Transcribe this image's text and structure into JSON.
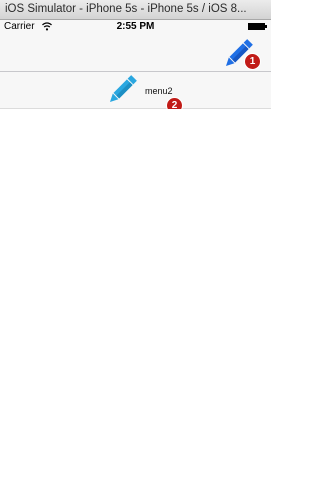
{
  "window": {
    "title": "iOS Simulator - iPhone 5s - iPhone 5s / iOS 8..."
  },
  "status_bar": {
    "carrier": "Carrier",
    "time": "2:55 PM",
    "wifi_icon": "wifi-icon",
    "battery_icon": "battery-icon"
  },
  "nav_bar": {
    "right_icon": "pencil-icon",
    "badge": "1"
  },
  "menu": {
    "icon": "pencil-icon",
    "label": "menu2",
    "badge": "2"
  },
  "colors": {
    "pencil_nav": "#1f6fe5",
    "pencil_menu": "#2aa7e0",
    "badge": "#c11b17"
  }
}
